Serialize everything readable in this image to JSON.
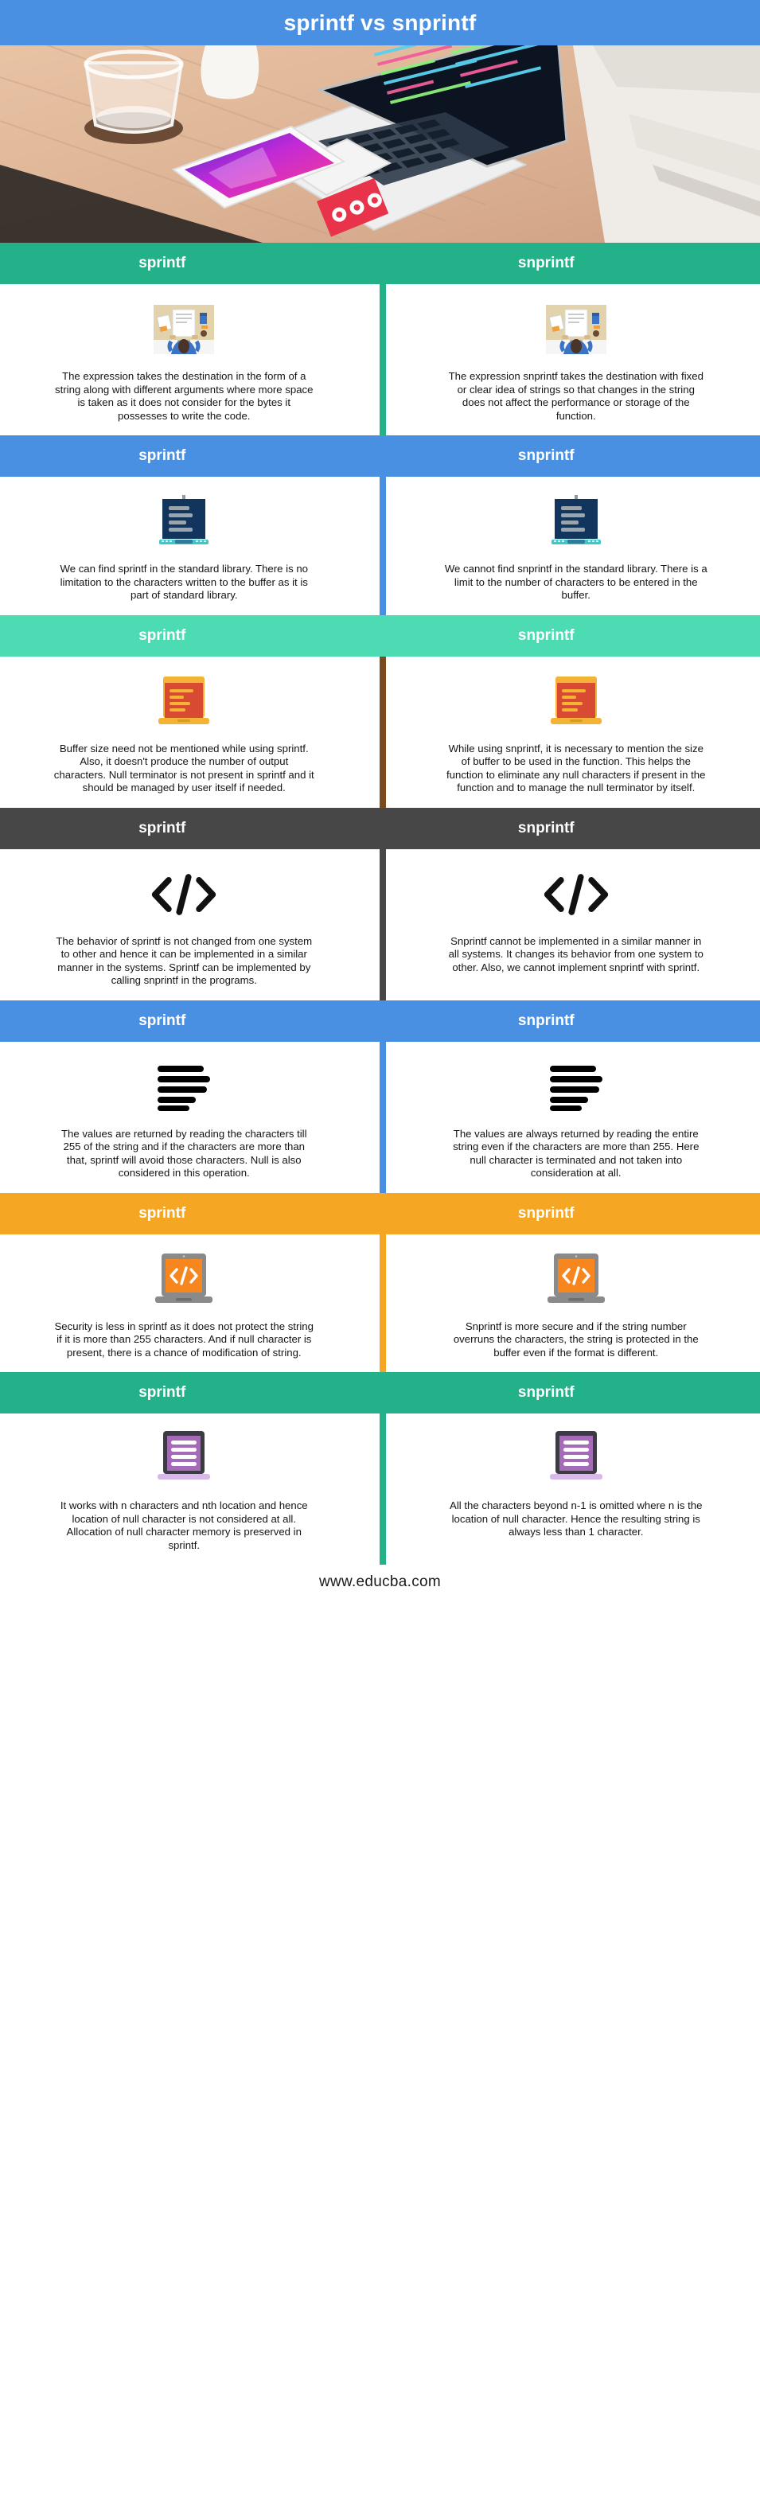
{
  "header": {
    "title": "sprintf vs snprintf",
    "bg_color": "#4a90e2"
  },
  "hero": {
    "alt": "laptop-on-desk-photo"
  },
  "column_labels": {
    "left": "sprintf",
    "right": "snprintf"
  },
  "sections": [
    {
      "band_color": "#23b189",
      "divider_color": "#23b189",
      "icon": "desk-workspace-icon",
      "left_label": "sprintf",
      "right_label": "snprintf",
      "left_text": "The expression takes the destination in the form of a string along with different arguments where more space is taken as it does not consider for the bytes it possesses to write the code.",
      "right_text": "The expression snprintf takes the destination with fixed or clear idea of strings so that changes in the string does not affect the performance or storage of the function."
    },
    {
      "band_color": "#4a90e2",
      "divider_color": "#4a90e2",
      "icon": "dark-monitor-icon",
      "left_label": "sprintf",
      "right_label": "snprintf",
      "left_text": "We can find sprintf in the standard library. There is no limitation to the characters written to the buffer as it is part of standard library.",
      "right_text": "We cannot find snprintf in the standard library. There is a limit to the number of characters to be entered in the buffer."
    },
    {
      "band_color": "#4ddbb4",
      "divider_color": "#7a4b1e",
      "icon": "red-laptop-icon",
      "left_label": "sprintf",
      "right_label": "snprintf",
      "left_text": "Buffer size need not be mentioned while using sprintf. Also, it doesn't produce the number of output characters. Null terminator is not present in sprintf and it should be managed by user itself if needed.",
      "right_text": "While using snprintf, it is necessary to mention the size of buffer to be used in the function. This helps the function to eliminate any null characters if present in the function and to manage the null terminator by itself."
    },
    {
      "band_color": "#474747",
      "divider_color": "#474747",
      "icon": "code-brackets-icon",
      "left_label": "sprintf",
      "right_label": "snprintf",
      "left_text": "The behavior of sprintf is not changed from one system to other and hence it can be implemented in a similar manner in the systems. Sprintf can be implemented by calling snprintf in the programs.",
      "right_text": "Snprintf cannot be implemented in a similar manner in all systems. It changes its behavior from one system to other. Also, we cannot implement snprintf with sprintf."
    },
    {
      "band_color": "#4a90e2",
      "divider_color": "#4a90e2",
      "icon": "align-lines-icon",
      "left_label": "sprintf",
      "right_label": "snprintf",
      "left_text": "The values are returned by reading the characters till 255 of the string and if the characters are more than that, sprintf will avoid those characters. Null is also considered in this operation.",
      "right_text": "The values are always returned by reading the entire string even if the characters are more than 255. Here null character is terminated and not taken into consideration at all."
    },
    {
      "band_color": "#f5a623",
      "divider_color": "#f5a623",
      "icon": "orange-laptop-code-icon",
      "left_label": "sprintf",
      "right_label": "snprintf",
      "left_text": "Security is less in sprintf as it does not protect the string if it is more than 255 characters. And if null character is present, there is a chance of modification of string.",
      "right_text": "Snprintf is more secure and if the string number overruns the characters, the string is protected in the buffer even if the format is different."
    },
    {
      "band_color": "#23b189",
      "divider_color": "#23b189",
      "icon": "purple-monitor-icon",
      "left_label": "sprintf",
      "right_label": "snprintf",
      "left_text": "It works with n characters and nth location and hence location of null character is not considered at all. Allocation of null character memory is preserved in sprintf.",
      "right_text": "All the characters beyond n-1 is omitted where n is the location of null character. Hence the resulting string is always less than 1 character."
    }
  ],
  "footer": {
    "url": "www.educba.com"
  }
}
